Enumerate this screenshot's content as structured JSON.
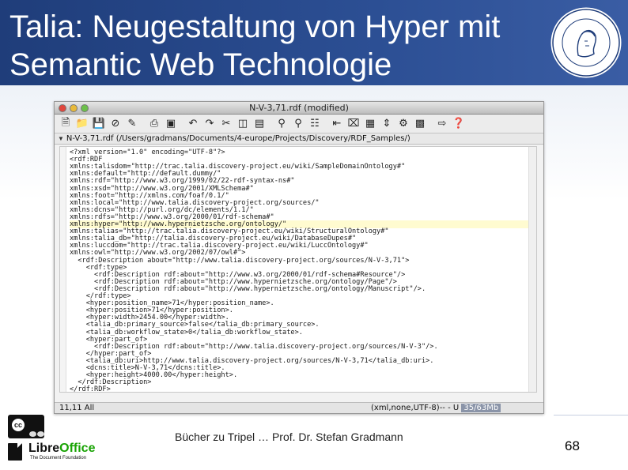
{
  "slide": {
    "title_line1": "Talia: Neugestaltung von Hyper mit",
    "title_line2": "Semantic Web Technologie",
    "footer": "Bücher zu Tripel … Prof. Dr. Stefan Gradmann",
    "page_number": "68"
  },
  "window": {
    "title": "N-V-3,71.rdf (modified)",
    "path": "N-V-3,71.rdf (/Users/gradmans/Documents/4-europe/Projects/Discovery/RDF_Samples/)",
    "toolbar_icons": [
      "new-file-icon",
      "open-file-icon",
      "save-icon",
      "close-file-icon",
      "edit-icon",
      "print-icon",
      "print-preview-icon",
      "undo-icon",
      "redo-icon",
      "cut-icon",
      "copy-icon",
      "paste-icon",
      "find-icon",
      "find-replace-icon",
      "options-icon",
      "close-all-icon",
      "toggle-icon",
      "split-icon",
      "macro-icon",
      "export-icon",
      "help-icon"
    ],
    "status_left": "11,11 All",
    "status_right": "(xml,none,UTF-8)-- - U",
    "memory": "35/63Mb"
  },
  "code_lines": [
    "<?xml version=\"1.0\" encoding=\"UTF-8\"?>",
    "<rdf:RDF",
    "xmlns:talisdom=\"http://trac.talia.discovery-project.eu/wiki/SampleDomainOntology#\"",
    "xmlns:default=\"http://default.dummy/\"",
    "xmlns:rdf=\"http://www.w3.org/1999/02/22-rdf-syntax-ns#\"",
    "xmlns:xsd=\"http://www.w3.org/2001/XMLSchema#\"",
    "xmlns:foot=\"http://xmlns.com/foaf/0.1/\"",
    "xmlns:local=\"http://www.talia.discovery-project.org/sources/\"",
    "xmlns:dcns=\"http://purl.org/dc/elements/1.1/\"",
    "xmlns:rdfs=\"http://www.w3.org/2000/01/rdf-schema#\"",
    "xmlns:hyper=\"http://www.hypernietzsche.org/ontology/\"",
    "xmlns:talias=\"http://trac.talia.discovery-project.eu/wiki/StructuralOntology#\"",
    "xmlns:talia_db=\"http://talia.discovery-project.eu/wiki/DatabaseDupes#\"",
    "xmlns:luccdom=\"http://trac.talia.discovery-project.eu/wiki/LuccOntology#\"",
    "xmlns:owl=\"http://www.w3.org/2002/07/owl#\">",
    "  <rdf:Description about=\"http://www.talia.discovery-project.org/sources/N-V-3,71\">",
    "    <rdf:type>",
    "      <rdf:Description rdf:about=\"http://www.w3.org/2000/01/rdf-schema#Resource\"/>",
    "      <rdf:Description rdf:about=\"http://www.hypernietzsche.org/ontology/Page\"/>",
    "      <rdf:Description rdf:about=\"http://www.hypernietzsche.org/ontology/Manuscript\"/>.",
    "    </rdf:type>",
    "    <hyper:position_name>71</hyper:position_name>.",
    "    <hyper:position>71</hyper:position>.",
    "    <hyper:width>2454.00</hyper:width>.",
    "    <talia_db:primary_source>false</talia_db:primary_source>.",
    "    <talia_db:workflow_state>0</talia_db:workflow_state>.",
    "    <hyper:part_of>",
    "      <rdf:Description rdf:about=\"http://www.talia.discovery-project.org/sources/N-V-3\"/>.",
    "    </hyper:part_of>",
    "    <talia_db:uri>http://www.talia.discovery-project.org/sources/N-V-3,71</talia_db:uri>.",
    "    <dcns:title>N-V-3,71</dcns:title>.",
    "    <hyper:height>4000.00</hyper:height>.",
    "  </rdf:Description>",
    "</rdf:RDF>"
  ]
}
